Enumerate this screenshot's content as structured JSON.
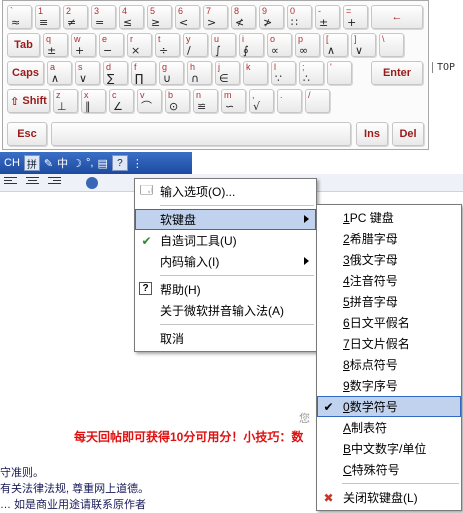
{
  "keyboard": {
    "side_label": "TOP",
    "rows": [
      [
        {
          "up": "`",
          "dn": "≈"
        },
        {
          "up": "1",
          "dn": "≡"
        },
        {
          "up": "2",
          "dn": "≠"
        },
        {
          "up": "3",
          "dn": "="
        },
        {
          "up": "4",
          "dn": "≤"
        },
        {
          "up": "5",
          "dn": "≥"
        },
        {
          "up": "6",
          "dn": "<"
        },
        {
          "up": "7",
          "dn": ">"
        },
        {
          "up": "8",
          "dn": "≮"
        },
        {
          "up": "9",
          "dn": "≯"
        },
        {
          "up": "0",
          "dn": "∷"
        },
        {
          "up": "-",
          "dn": "±"
        },
        {
          "up": "=",
          "dn": "+"
        }
      ],
      [
        {
          "up": "q",
          "dn": "±"
        },
        {
          "up": "w",
          "dn": "+"
        },
        {
          "up": "e",
          "dn": "−"
        },
        {
          "up": "r",
          "dn": "×"
        },
        {
          "up": "t",
          "dn": "÷"
        },
        {
          "up": "y",
          "dn": "/"
        },
        {
          "up": "u",
          "dn": "∫"
        },
        {
          "up": "i",
          "dn": "∮"
        },
        {
          "up": "o",
          "dn": "∝"
        },
        {
          "up": "p",
          "dn": "∞"
        },
        {
          "up": "[",
          "dn": "∧"
        },
        {
          "up": "]",
          "dn": "∨"
        },
        {
          "up": "\\",
          "dn": ""
        }
      ],
      [
        {
          "up": "a",
          "dn": "∧"
        },
        {
          "up": "s",
          "dn": "∨"
        },
        {
          "up": "d",
          "dn": "∑"
        },
        {
          "up": "f",
          "dn": "∏"
        },
        {
          "up": "g",
          "dn": "∪"
        },
        {
          "up": "h",
          "dn": "∩"
        },
        {
          "up": "j",
          "dn": "∈"
        },
        {
          "up": "k",
          "dn": ""
        },
        {
          "up": "l",
          "dn": "∵"
        },
        {
          "up": ";",
          "dn": "∴"
        },
        {
          "up": "'",
          "dn": ""
        }
      ],
      [
        {
          "up": "z",
          "dn": "⊥"
        },
        {
          "up": "x",
          "dn": "∥"
        },
        {
          "up": "c",
          "dn": "∠"
        },
        {
          "up": "v",
          "dn": "⌒"
        },
        {
          "up": "b",
          "dn": "⊙"
        },
        {
          "up": "n",
          "dn": "≌"
        },
        {
          "up": "m",
          "dn": "∽"
        },
        {
          "up": ",",
          "dn": "√"
        },
        {
          "up": ".",
          "dn": ""
        },
        {
          "up": "/",
          "dn": ""
        }
      ]
    ],
    "keys": {
      "tab": "Tab",
      "caps": "Caps",
      "shift": "Shift",
      "enter": "Enter",
      "esc": "Esc",
      "ins": "Ins",
      "del": "Del",
      "backspace": "←"
    }
  },
  "langbar": {
    "lang": "CH",
    "mode": "中"
  },
  "page": {
    "faint": "您",
    "hint_prefix": "每天回帖即可获得10分可用分！",
    "hint_tip": "小技巧：数",
    "rules": [
      "守准则。",
      "有关法律法规, 尊重网上道德。",
      "…  如是商业用途请联系原作者"
    ]
  },
  "menu_main": {
    "items": [
      {
        "icon": "input-options-icon",
        "label": "输入选项(O)..."
      },
      {
        "sep": true
      },
      {
        "label": "软键盘",
        "arrow": true,
        "highlighted": true
      },
      {
        "icon": "custom-word-tool-icon",
        "label": "自造词工具(U)"
      },
      {
        "label": "内码输入(I)",
        "arrow": true
      },
      {
        "sep": true
      },
      {
        "icon": "help-icon",
        "label": "帮助(H)"
      },
      {
        "label": "关于微软拼音输入法(A)"
      },
      {
        "sep": true
      },
      {
        "label": "取消"
      }
    ]
  },
  "menu_sub": {
    "items": [
      {
        "key": "1",
        "label": "PC 键盘"
      },
      {
        "key": "2",
        "label": "希腊字母"
      },
      {
        "key": "3",
        "label": "俄文字母"
      },
      {
        "key": "4",
        "label": "注音符号"
      },
      {
        "key": "5",
        "label": "拼音字母"
      },
      {
        "key": "6",
        "label": "日文平假名"
      },
      {
        "key": "7",
        "label": "日文片假名"
      },
      {
        "key": "8",
        "label": "标点符号"
      },
      {
        "key": "9",
        "label": "数字序号"
      },
      {
        "key": "0",
        "label": "数学符号",
        "checked": true,
        "highlighted": true
      },
      {
        "key": "A",
        "label": "制表符"
      },
      {
        "key": "B",
        "label": "中文数字/单位"
      },
      {
        "key": "C",
        "label": "特殊符号"
      },
      {
        "sep": true
      },
      {
        "icon": "close-soft-keyboard-icon",
        "label": "关闭软键盘(L)"
      }
    ]
  }
}
